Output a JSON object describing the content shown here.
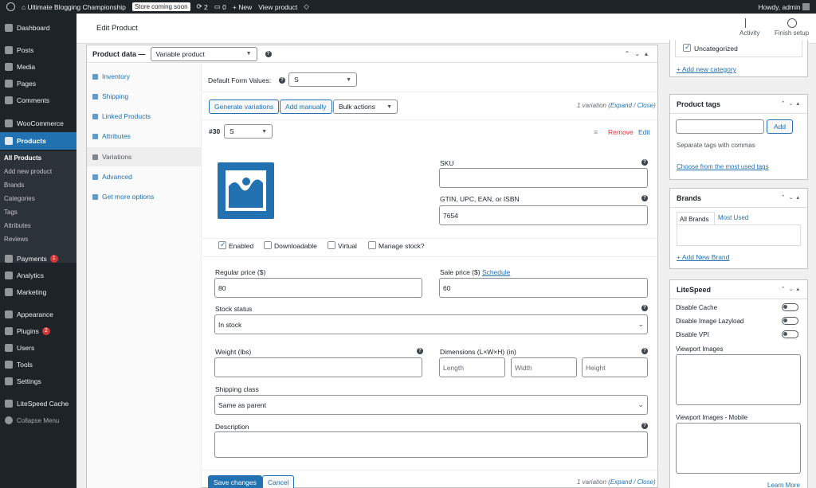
{
  "adminbar": {
    "site_name": "Ultimate Blogging Championship",
    "store_badge": "Store coming soon",
    "updates_count": "2",
    "comments_count": "0",
    "new_label": "New",
    "view_product": "View product",
    "howdy": "Howdy, admin"
  },
  "sidebar": {
    "items": [
      {
        "label": "Dashboard",
        "icon": "dashboard-icon"
      },
      {
        "label": "Posts",
        "icon": "pin-icon"
      },
      {
        "label": "Media",
        "icon": "media-icon"
      },
      {
        "label": "Pages",
        "icon": "pages-icon"
      },
      {
        "label": "Comments",
        "icon": "comment-icon"
      },
      {
        "label": "WooCommerce",
        "icon": "woo-icon"
      },
      {
        "label": "Products",
        "icon": "archive-icon"
      },
      {
        "label": "Payments",
        "icon": "payments-icon",
        "badge": "1"
      },
      {
        "label": "Analytics",
        "icon": "analytics-icon"
      },
      {
        "label": "Marketing",
        "icon": "megaphone-icon"
      },
      {
        "label": "Appearance",
        "icon": "brush-icon"
      },
      {
        "label": "Plugins",
        "icon": "plugin-icon",
        "badge": "2"
      },
      {
        "label": "Users",
        "icon": "users-icon"
      },
      {
        "label": "Tools",
        "icon": "tools-icon"
      },
      {
        "label": "Settings",
        "icon": "settings-icon"
      },
      {
        "label": "LiteSpeed Cache",
        "icon": "litespeed-icon"
      },
      {
        "label": "Collapse Menu",
        "icon": "collapse-icon"
      }
    ],
    "submenu": [
      "All Products",
      "Add new product",
      "Brands",
      "Categories",
      "Tags",
      "Attributes",
      "Reviews"
    ]
  },
  "header": {
    "title": "Edit Product",
    "activity": "Activity",
    "finish_setup": "Finish setup"
  },
  "product_data": {
    "label": "Product data —",
    "type": "Variable product",
    "tabs": [
      "Inventory",
      "Shipping",
      "Linked Products",
      "Attributes",
      "Variations",
      "Advanced",
      "Get more options"
    ],
    "default_form_values_label": "Default Form Values:",
    "default_form_value": "S",
    "generate_variations": "Generate variations",
    "add_manually": "Add manually",
    "bulk_actions": "Bulk actions",
    "variation_count": "1 variation",
    "expand": "Expand",
    "close": "Close",
    "variation_id": "#30",
    "variation_value": "S",
    "remove": "Remove",
    "edit": "Edit",
    "sku_label": "SKU",
    "sku_value": "",
    "gtin_label": "GTIN, UPC, EAN, or ISBN",
    "gtin_value": "7654",
    "enabled_label": "Enabled",
    "enabled": true,
    "downloadable_label": "Downloadable",
    "downloadable": false,
    "virtual_label": "Virtual",
    "virtual": false,
    "manage_stock_label": "Manage stock?",
    "manage_stock": false,
    "regular_price_label": "Regular price ($)",
    "regular_price": "80",
    "sale_price_label": "Sale price ($)",
    "schedule": "Schedule",
    "sale_price": "60",
    "stock_status_label": "Stock status",
    "stock_status": "In stock",
    "weight_label": "Weight (lbs)",
    "weight": "",
    "dimensions_label": "Dimensions (L×W×H) (in)",
    "length_ph": "Length",
    "width_ph": "Width",
    "height_ph": "Height",
    "shipping_class_label": "Shipping class",
    "shipping_class": "Same as parent",
    "description_label": "Description",
    "save_changes": "Save changes",
    "cancel": "Cancel"
  },
  "right": {
    "uncategorized": "Uncategorized",
    "add_category": "+ Add new category",
    "tags_title": "Product tags",
    "tags_add": "Add",
    "tags_hint": "Separate tags with commas",
    "tags_choose": "Choose from the most used tags",
    "brands_title": "Brands",
    "brands_all": "All Brands",
    "brands_most": "Most Used",
    "brands_add": "+ Add New Brand",
    "ls_title": "LiteSpeed",
    "ls_disable_cache": "Disable Cache",
    "ls_disable_lazy": "Disable Image Lazyload",
    "ls_disable_vpi": "Disable VPI",
    "ls_viewport": "Viewport Images",
    "ls_viewport_mobile": "Viewport Images - Mobile",
    "learn_more": "Learn More"
  },
  "colors": {
    "accent": "#2271b1",
    "danger": "#d63638",
    "sidebar": "#1d2327"
  }
}
